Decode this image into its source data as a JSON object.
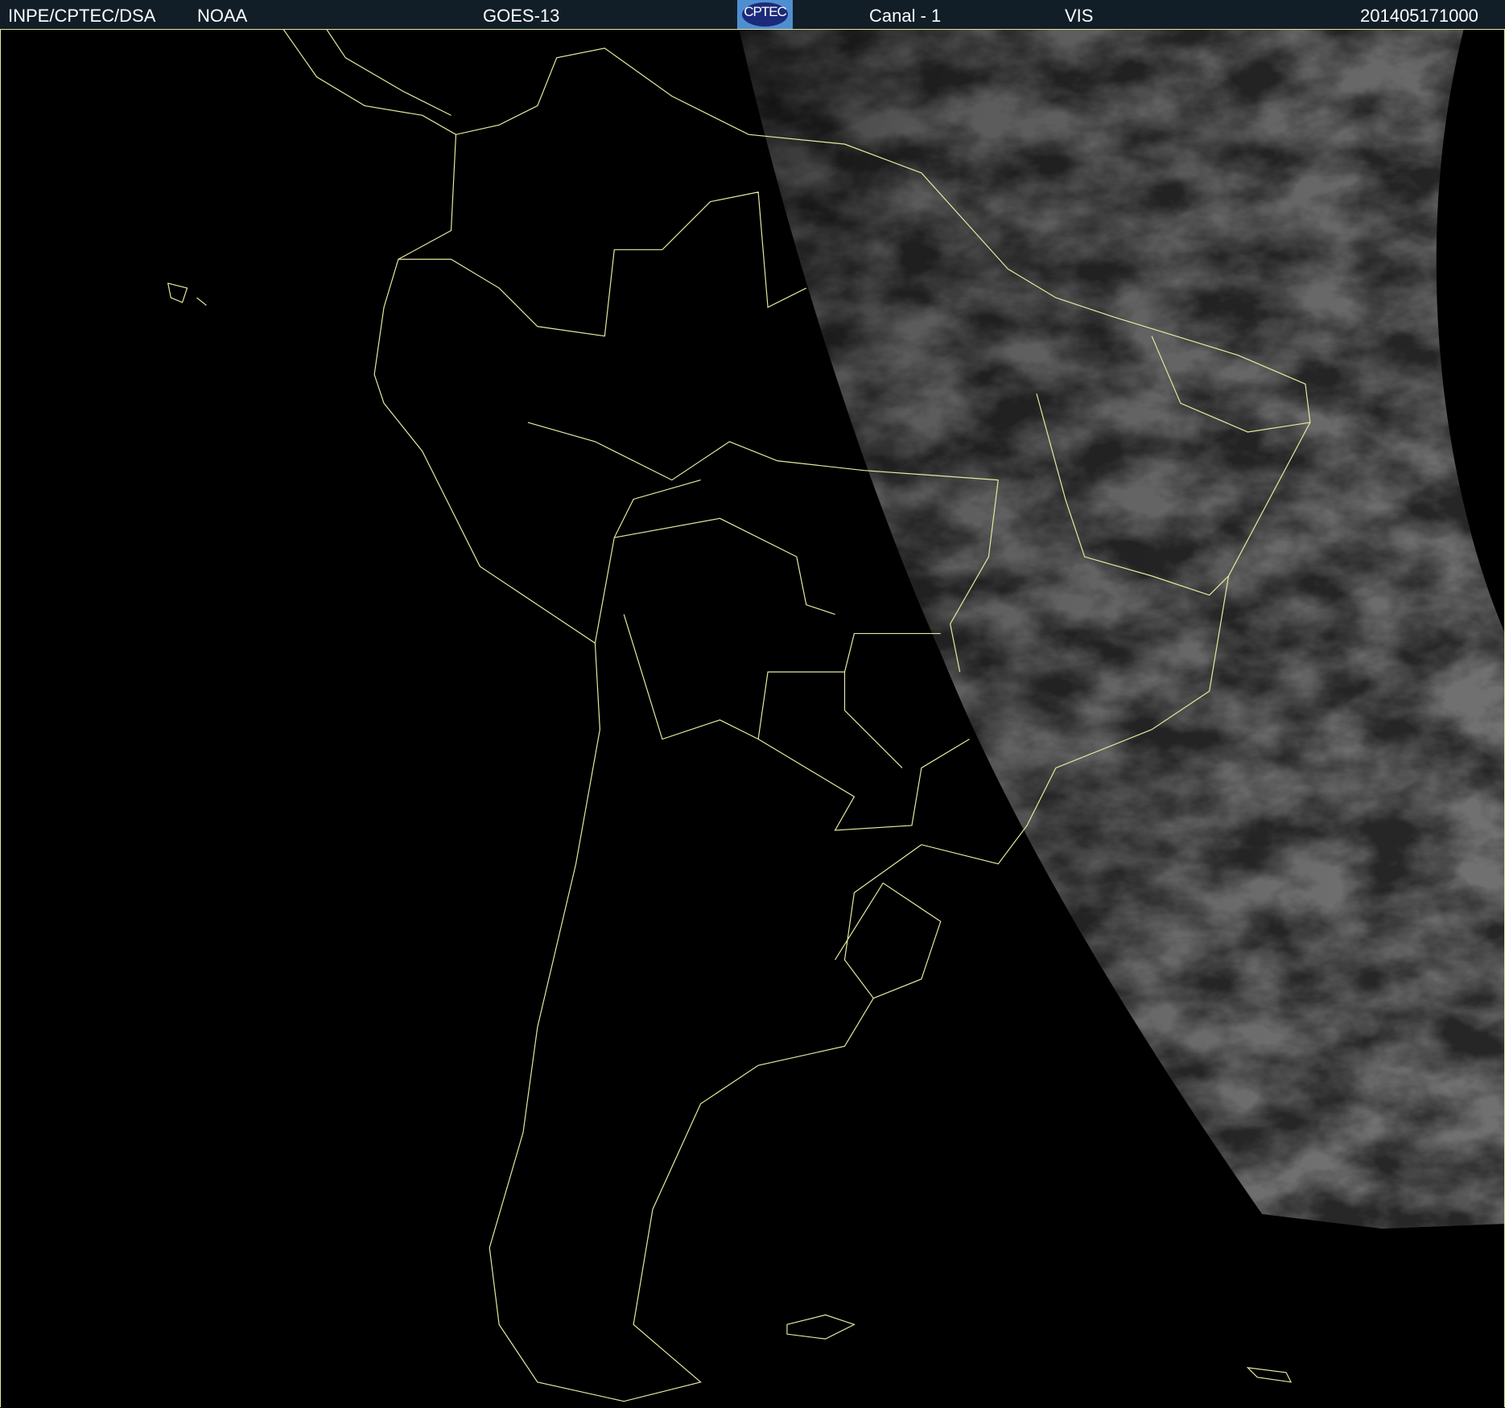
{
  "header": {
    "institution": "INPE/CPTEC/DSA",
    "agency": "NOAA",
    "satellite": "GOES-13",
    "logo_text": "CPTEC",
    "channel": "Canal - 1",
    "band": "VIS",
    "timestamp": "201405171000"
  },
  "colors": {
    "header_bg": "#111e28",
    "coastline": "#e8e8a0",
    "background": "#000000"
  }
}
